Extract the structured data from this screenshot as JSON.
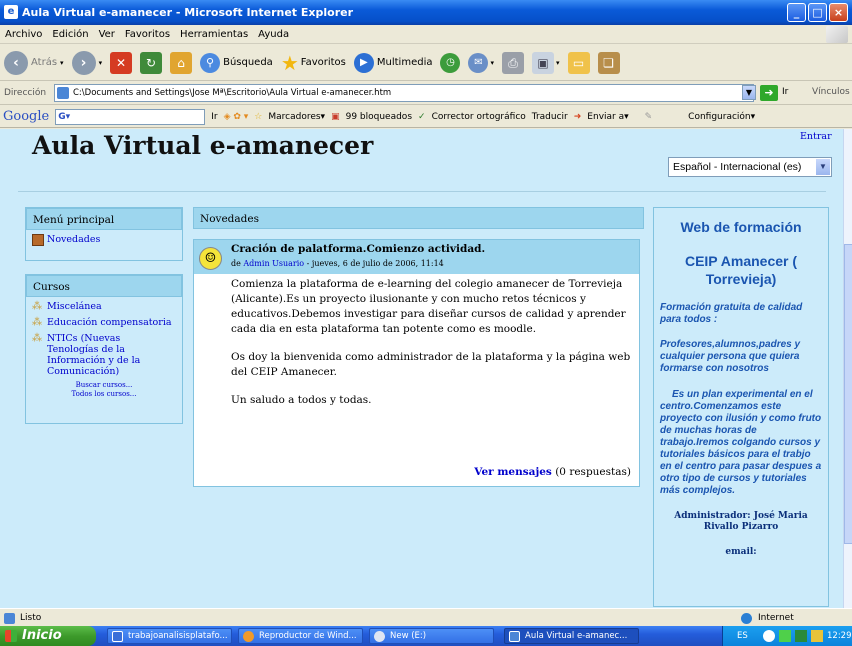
{
  "window": {
    "title": "Aula Virtual e-amanecer - Microsoft Internet Explorer"
  },
  "menu": [
    "Archivo",
    "Edición",
    "Ver",
    "Favoritos",
    "Herramientas",
    "Ayuda"
  ],
  "toolbar": {
    "back": "Atrás",
    "search": "Búsqueda",
    "favorites": "Favoritos",
    "media": "Multimedia"
  },
  "address": {
    "label": "Dirección",
    "value": "C:\\Documents and Settings\\Jose Mª\\Escritorio\\Aula Virtual e-amanecer.htm",
    "go": "Ir",
    "links": "Vínculos"
  },
  "google": {
    "logo": "Google",
    "field": "G▾",
    "go": "Ir",
    "bookmarks": "Marcadores▾",
    "blocked": "99 bloqueados",
    "spell": "Corrector ortográfico",
    "translate": "Traducir",
    "send": "Enviar a▾",
    "settings": "Configuración▾"
  },
  "site": {
    "title": "Aula Virtual e-amanecer",
    "login": "Entrar",
    "language": "Español - Internacional (es)"
  },
  "menu_block": {
    "title": "Menú principal",
    "items": [
      "Novedades"
    ]
  },
  "courses_block": {
    "title": "Cursos",
    "items": [
      "Miscelánea",
      "Educación compensatoria",
      "NTICs (Nuevas Tenologías de la Información y de la Comunicación)"
    ],
    "search": "Buscar cursos...",
    "all": "Todos los cursos..."
  },
  "news": {
    "header": "Novedades",
    "post": {
      "title": "Cración de palatforma.Comienzo actividad.",
      "by": "de",
      "author": "Admin Usuario",
      "date": " - jueves, 6 de julio de 2006, 11:14",
      "paragraphs": [
        "Comienza la plataforma de e-learning del colegio amanecer de Torrevieja (Alicante).Es un proyecto ilusionante y con mucho retos técnicos y educativos.Debemos investigar para diseñar cursos de calidad y aprender cada dia en esta plataforma tan potente como es moodle.",
        "Os doy la bienvenida como administrador de la plataforma y la página web del CEIP Amanecer.",
        "Un saludo a todos y todas."
      ],
      "more_link": "Ver mensajes",
      "replies": "(0 respuestas)"
    }
  },
  "right_block": {
    "title": "Web de formación",
    "school": "CEIP Amanecer ( Torrevieja)",
    "p1": "Formación gratuita de calidad para todos :",
    "p2": "Profesores,alumnos,padres y cualquier persona que quiera formarse con nosotros",
    "p3": "Es un plan experimental en el centro.Comenzamos este proyecto con ilusión y como fruto de muchas horas de trabajo.Iremos colgando cursos y tutoriales básicos para el trabjo en el centro para pasar despues a otro tipo de cursos y tutoriales más complejos.",
    "admin": "Administrador: José Maria Rivallo Pizarro",
    "email": "email:"
  },
  "status": {
    "text": "Listo",
    "zone": "Internet"
  },
  "taskbar": {
    "start": "Inicio",
    "tasks": [
      "trabajoanalisisplatafo...",
      "Reproductor de Wind...",
      "New (E:)",
      "Aula Virtual e-amanec..."
    ],
    "lang": "ES",
    "clock": "12:29"
  }
}
